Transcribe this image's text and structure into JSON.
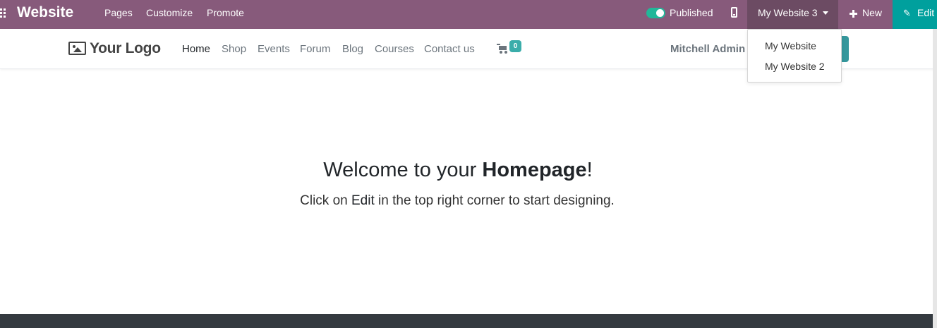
{
  "adminbar": {
    "brand": "Website",
    "menu": [
      "Pages",
      "Customize",
      "Promote"
    ],
    "published_label": "Published",
    "published_on": true,
    "current_site": "My Website 3",
    "new_label": "New",
    "edit_label": "Edit"
  },
  "site_switcher": {
    "options": [
      "My Website",
      "My Website 2"
    ]
  },
  "header": {
    "logo_text": "Your Logo",
    "nav": [
      "Home",
      "Shop",
      "Events",
      "Forum",
      "Blog",
      "Courses",
      "Contact us"
    ],
    "active_nav": "Home",
    "cart_count": "0",
    "user_name": "Mitchell Admin"
  },
  "main": {
    "welcome_prefix": "Welcome to your ",
    "welcome_bold": "Homepage",
    "welcome_suffix": "!",
    "sub_prefix": "Click on ",
    "sub_bold": "Edit",
    "sub_suffix": " in the top right corner to start designing."
  },
  "colors": {
    "admin_bar": "#875a7b",
    "admin_bar_active": "#6c4b63",
    "edit_button": "#00a09d",
    "toggle_on": "#21b799",
    "cart_badge": "#3aadaa",
    "footer": "#343a40"
  }
}
